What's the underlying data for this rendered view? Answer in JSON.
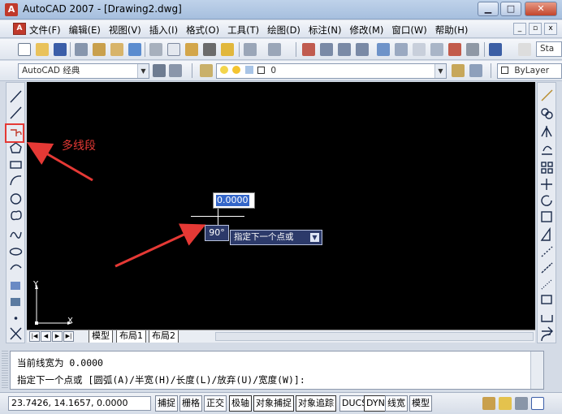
{
  "window": {
    "title": "AutoCAD 2007 - [Drawing2.dwg]",
    "minimize": "▁",
    "maximize": "□",
    "close": "✕"
  },
  "menu": {
    "items": [
      "文件(F)",
      "编辑(E)",
      "视图(V)",
      "插入(I)",
      "格式(O)",
      "工具(T)",
      "绘图(D)",
      "标注(N)",
      "修改(M)",
      "窗口(W)",
      "帮助(H)"
    ],
    "doc_minimize": "_",
    "doc_restore": "▫",
    "doc_close": "x"
  },
  "toolbar": {
    "style_search_placeholder": "Sta",
    "workspace": "AutoCAD 经典",
    "layer": "0",
    "color": "ByLayer"
  },
  "annotation": {
    "label": "多线段",
    "color": "#e53935"
  },
  "dynamic_input": {
    "value": "0.0000",
    "angle": "90°",
    "prompt": "指定下一个点或"
  },
  "ucs": {
    "x_label": "X",
    "y_label": "Y"
  },
  "layout_tabs": [
    "模型",
    "布局1",
    "布局2"
  ],
  "command": {
    "line1": "当前线宽为 0.0000",
    "line2": "指定下一个点或 [圆弧(A)/半宽(H)/长度(L)/放弃(U)/宽度(W)]:"
  },
  "status": {
    "coordinates": "23.7426, 14.1657, 0.0000",
    "buttons": [
      "捕捉",
      "栅格",
      "正交",
      "极轴",
      "对象捕捉",
      "对象追踪",
      "DUCS",
      "DYN",
      "线宽",
      "模型"
    ]
  },
  "colors": {
    "canvas": "#000000",
    "accent_red": "#e53935",
    "dyn_blue": "#2c3a6a"
  }
}
